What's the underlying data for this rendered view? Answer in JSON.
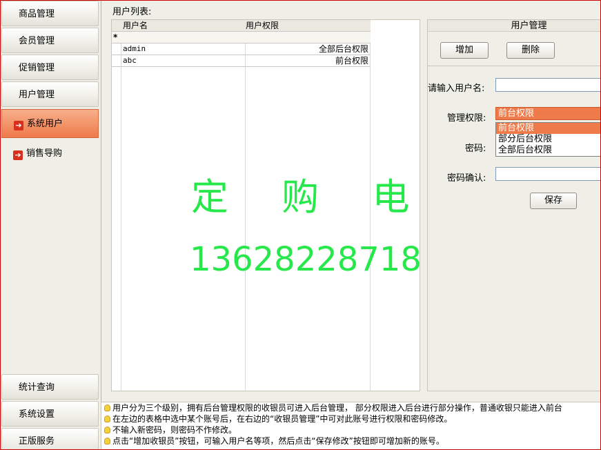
{
  "sidebar": {
    "top_items": [
      "商品管理",
      "会员管理",
      "促销管理",
      "用户管理"
    ],
    "sub_items": [
      "系统用户",
      "销售导购"
    ],
    "bottom_items": [
      "统计查询",
      "系统设置",
      "正版服务"
    ]
  },
  "user_list": {
    "title": "用户列表:",
    "columns": [
      "用户名",
      "用户权限"
    ],
    "new_row_marker": "*",
    "rows": [
      {
        "name": "admin",
        "permission": "全部后台权限"
      },
      {
        "name": "abc",
        "permission": "前台权限"
      }
    ]
  },
  "watermark": {
    "title": "定 购 电 话",
    "phone": "13628228718"
  },
  "user_management": {
    "title": "用户管理",
    "add_button": "增加",
    "delete_button": "删除",
    "username_label": "请输入用户名:",
    "username_value": "",
    "permission_label": "管理权限:",
    "permission_selected": "前台权限",
    "permission_options": [
      "前台权限",
      "部分后台权限",
      "全部后台权限"
    ],
    "password_label": "密码:",
    "confirm_label": "密码确认:",
    "save_button": "保存"
  },
  "tips": [
    "用户分为三个级别，拥有后台管理权限的收银员可进入后台管理，  部分权限进入后台进行部分操作，普通收银只能进入前台",
    "在左边的表格中选中某个账号后，在右边的“收银员管理”中可对此账号进行权限和密码修改。",
    "不输入新密码，则密码不作修改。",
    "点击“增加收银员”按钮，可输入用户名等项，然后点击“保存修改”按钮即可增加新的账号。"
  ],
  "colors": {
    "active_nav": "#ef7a4a",
    "watermark": "#27e84a",
    "frame_border": "#c80000"
  }
}
